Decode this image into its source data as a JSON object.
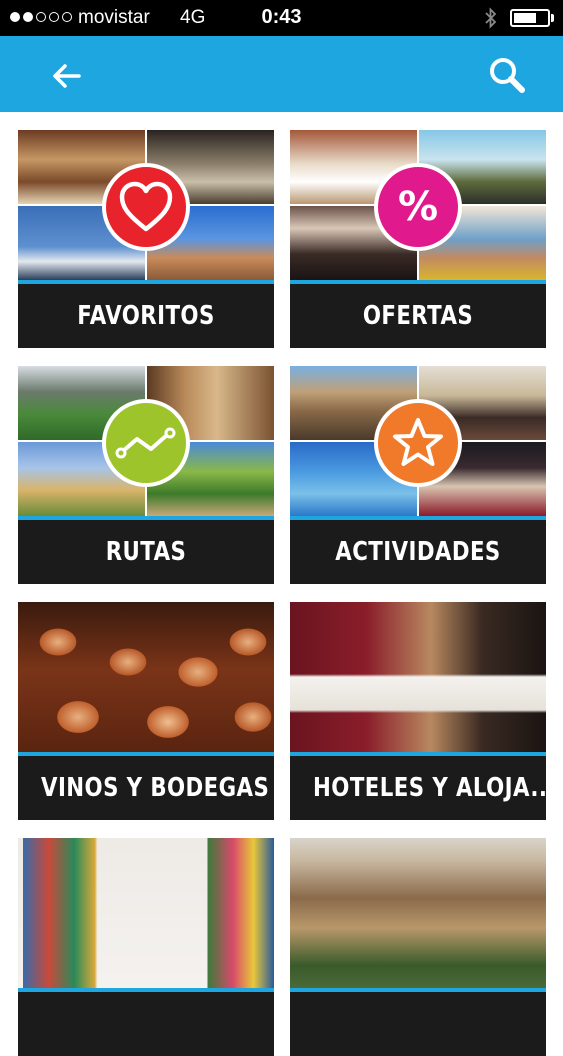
{
  "status_bar": {
    "carrier": "movistar",
    "network": "4G",
    "time": "0:43",
    "signal_bars_filled": 2,
    "signal_bars_total": 5,
    "battery_level": 0.6
  },
  "nav_bar": {
    "back_icon": "arrow-left-icon",
    "search_icon": "magnifier-icon",
    "color": "#1ea6e0"
  },
  "categories": [
    {
      "id": "favoritos",
      "label": "FAVORITOS",
      "badge_icon": "heart-icon",
      "badge_color": "#e8232b"
    },
    {
      "id": "ofertas",
      "label": "OFERTAS",
      "badge_icon": "percent-icon",
      "badge_text": "%",
      "badge_color": "#e0198c"
    },
    {
      "id": "rutas",
      "label": "RUTAS",
      "badge_icon": "route-icon",
      "badge_color": "#9ec42c"
    },
    {
      "id": "actividades",
      "label": "ACTIVIDADES",
      "badge_icon": "star-icon",
      "badge_color": "#f07a2a"
    },
    {
      "id": "vinos",
      "label": "VINOS Y BODEGAS"
    },
    {
      "id": "hoteles",
      "label": "HOTELES Y ALOJA..."
    },
    {
      "id": "museos",
      "label": ""
    },
    {
      "id": "monumentos",
      "label": ""
    }
  ]
}
